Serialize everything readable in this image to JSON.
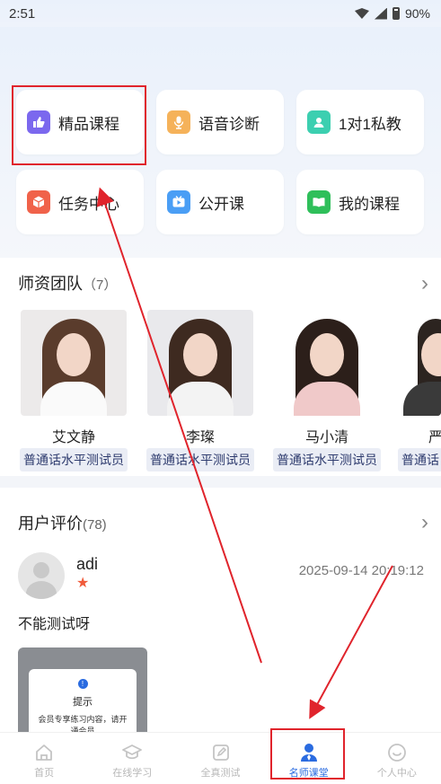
{
  "status_bar": {
    "time": "2:51",
    "battery": "90%"
  },
  "menu": [
    {
      "label": "精品课程",
      "icon": "thumbs-up-icon",
      "color": "#7b68ee"
    },
    {
      "label": "语音诊断",
      "icon": "microphone-icon",
      "color": "#f5b25a"
    },
    {
      "label": "1对1私教",
      "icon": "chat-user-icon",
      "color": "#3ccfb0"
    },
    {
      "label": "任务中心",
      "icon": "box-icon",
      "color": "#f0624a"
    },
    {
      "label": "公开课",
      "icon": "tv-play-icon",
      "color": "#4a9ef5"
    },
    {
      "label": "我的课程",
      "icon": "book-icon",
      "color": "#2fbf5a"
    }
  ],
  "teachers": {
    "title": "师资团队",
    "count": "（7）",
    "items": [
      {
        "name": "艾文静",
        "role": "普通话水平测试员"
      },
      {
        "name": "李璨",
        "role": "普通话水平测试员"
      },
      {
        "name": "马小清",
        "role": "普通话水平测试员"
      },
      {
        "name": "严",
        "role": "普通话"
      }
    ]
  },
  "reviews": {
    "title": "用户评价",
    "count": "(78)",
    "item": {
      "user": "adi",
      "time": "2025-09-14 20:19:12",
      "text": "不能测试呀",
      "thumb": {
        "title": "提示",
        "body": "会员专享练习内容，请开通会员"
      }
    }
  },
  "nav": [
    {
      "label": "首页",
      "icon": "home-icon",
      "active": false
    },
    {
      "label": "在线学习",
      "icon": "graduation-cap-icon",
      "active": false
    },
    {
      "label": "全真测试",
      "icon": "pencil-icon",
      "active": false
    },
    {
      "label": "名师课堂",
      "icon": "teacher-icon",
      "active": true
    },
    {
      "label": "个人中心",
      "icon": "smile-icon",
      "active": false
    }
  ],
  "colors": {
    "accent": "#2a6be0",
    "annotation": "#e0242c"
  }
}
